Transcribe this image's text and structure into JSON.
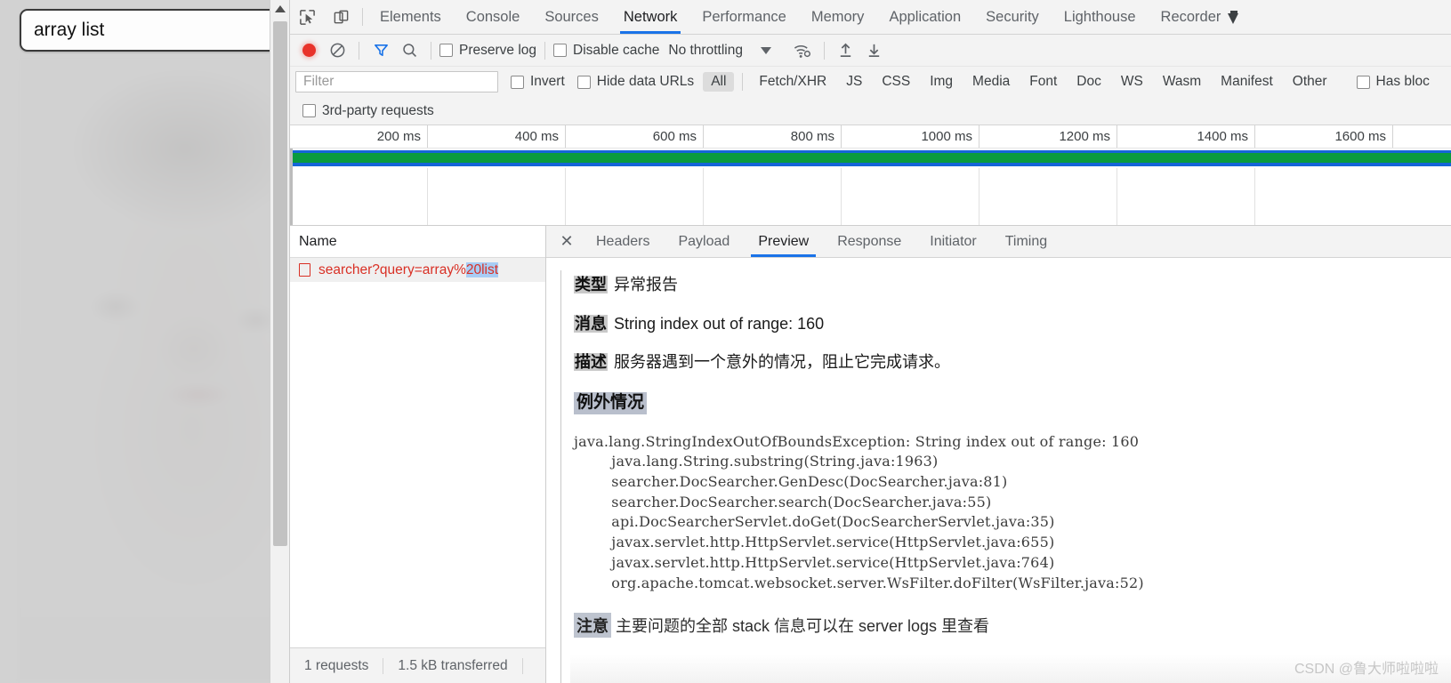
{
  "webpage": {
    "search_value": "array list",
    "background_alt": "faded portrait photo"
  },
  "devtools": {
    "main_tabs": [
      {
        "label": "Elements",
        "active": false
      },
      {
        "label": "Console",
        "active": false
      },
      {
        "label": "Sources",
        "active": false
      },
      {
        "label": "Network",
        "active": true
      },
      {
        "label": "Performance",
        "active": false
      },
      {
        "label": "Memory",
        "active": false
      },
      {
        "label": "Application",
        "active": false
      },
      {
        "label": "Security",
        "active": false
      },
      {
        "label": "Lighthouse",
        "active": false
      },
      {
        "label": "Recorder",
        "active": false,
        "experimental": true
      }
    ],
    "network_controls": {
      "preserve_log": "Preserve log",
      "disable_cache": "Disable cache",
      "throttling": "No throttling",
      "record_title": "record",
      "clear_title": "clear",
      "filter_title": "filter",
      "search_title": "search"
    },
    "filter_row": {
      "filter_placeholder": "Filter",
      "invert": "Invert",
      "hide_data_urls": "Hide data URLs",
      "types": [
        {
          "label": "All",
          "active": true
        },
        {
          "label": "Fetch/XHR",
          "active": false
        },
        {
          "label": "JS",
          "active": false
        },
        {
          "label": "CSS",
          "active": false
        },
        {
          "label": "Img",
          "active": false
        },
        {
          "label": "Media",
          "active": false
        },
        {
          "label": "Font",
          "active": false
        },
        {
          "label": "Doc",
          "active": false
        },
        {
          "label": "WS",
          "active": false
        },
        {
          "label": "Wasm",
          "active": false
        },
        {
          "label": "Manifest",
          "active": false
        },
        {
          "label": "Other",
          "active": false
        }
      ],
      "has_blocked": "Has bloc"
    },
    "third_party": "3rd-party requests",
    "timeline": {
      "ticks": [
        "200 ms",
        "400 ms",
        "600 ms",
        "800 ms",
        "1000 ms",
        "1200 ms",
        "1400 ms",
        "1600 ms"
      ],
      "band_green": "#0a9b3e",
      "band_blue": "#1565d8"
    },
    "request_list": {
      "column_header": "Name",
      "rows": [
        {
          "name_plain": "searcher?query=array%",
          "name_selected": "20list",
          "error": true
        }
      ]
    },
    "status_bar": {
      "requests": "1 requests",
      "transferred": "1.5 kB transferred"
    },
    "detail_tabs": [
      {
        "label": "Headers",
        "active": false
      },
      {
        "label": "Payload",
        "active": false
      },
      {
        "label": "Preview",
        "active": true
      },
      {
        "label": "Response",
        "active": false
      },
      {
        "label": "Initiator",
        "active": false
      },
      {
        "label": "Timing",
        "active": false
      }
    ],
    "preview": {
      "type_label": "类型",
      "type_value": "异常报告",
      "message_label": "消息",
      "message_value": "String index out of range: 160",
      "description_label": "描述",
      "description_value": "服务器遇到一个意外的情况，阻止它完成请求。",
      "exception_heading": "例外情况",
      "stack_trace": "java.lang.StringIndexOutOfBoundsException: String index out of range: 160\n        java.lang.String.substring(String.java:1963)\n        searcher.DocSearcher.GenDesc(DocSearcher.java:81)\n        searcher.DocSearcher.search(DocSearcher.java:55)\n        api.DocSearcherServlet.doGet(DocSearcherServlet.java:35)\n        javax.servlet.http.HttpServlet.service(HttpServlet.java:655)\n        javax.servlet.http.HttpServlet.service(HttpServlet.java:764)\n        org.apache.tomcat.websocket.server.WsFilter.doFilter(WsFilter.java:52)",
      "note_label": "注意",
      "note_value": "主要问题的全部 stack 信息可以在 server logs 里查看"
    }
  },
  "watermark": "CSDN @鲁大师啦啦啦"
}
